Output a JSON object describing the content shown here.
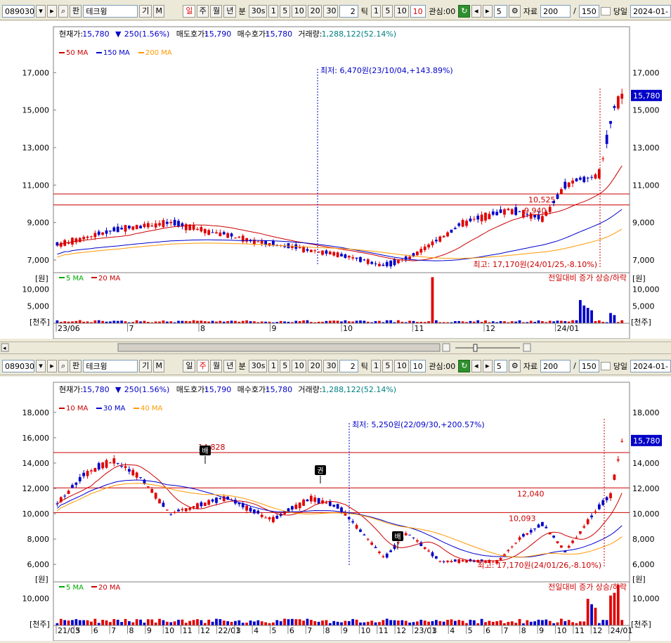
{
  "toolbar1": {
    "code": "089030",
    "pan": "판",
    "name": "테크윙",
    "gi": "기",
    "m": "M",
    "periods": [
      "일",
      "주",
      "월",
      "년",
      "분"
    ],
    "active_period": "일",
    "sec": "30s",
    "nums": [
      "1",
      "5",
      "10",
      "20",
      "30"
    ],
    "tick_count": "2",
    "tick_lbl": "틱",
    "tick_nums": [
      "1",
      "5",
      "10"
    ],
    "tick_active": "10",
    "gwansim": "관심:00",
    "spin": "5",
    "jaryo": "자료",
    "count": "200",
    "slash": "/",
    "total": "150",
    "dangil": "당일",
    "date": "2024-01-"
  },
  "toolbar2": {
    "code": "089030",
    "pan": "판",
    "name": "테크윙",
    "gi": "기",
    "m": "M",
    "periods": [
      "일",
      "주",
      "월",
      "년",
      "분"
    ],
    "active_period": "주",
    "sec": "30s",
    "nums": [
      "1",
      "5",
      "10",
      "20",
      "30"
    ],
    "tick_count": "2",
    "tick_lbl": "틱",
    "tick_nums": [
      "1",
      "5",
      "10"
    ],
    "tick_active": "10",
    "gwansim": "관심:00",
    "spin": "5",
    "jaryo": "자료",
    "count": "200",
    "slash": "/",
    "total": "150",
    "dangil": "당일",
    "date": "2024-01-"
  },
  "colors": {
    "up": "#e00000",
    "down": "#0000c8",
    "ma_red": "#cc0000",
    "ma_blue": "#0000cc",
    "ma_orange": "#ff9900",
    "vma_green": "#00aa00"
  },
  "chart1": {
    "info": {
      "cur_lbl": "현재가:",
      "cur": "15,780",
      "chg_arrow": "▼",
      "chg": "250(1.56%)",
      "ask_lbl": "매도호가:",
      "ask": "15,790",
      "bid_lbl": "매수호가:",
      "bid": "15,780",
      "vol_lbl": "거래량:",
      "vol": "1,288,122(52.14%)"
    },
    "legend": [
      {
        "name": "50 MA",
        "color": "#cc0000"
      },
      {
        "name": "150 MA",
        "color": "#0000cc"
      },
      {
        "name": "200 MA",
        "color": "#ff9900"
      }
    ],
    "vlegend": [
      {
        "name": "5 MA",
        "color": "#00aa00"
      },
      {
        "name": "20 MA",
        "color": "#cc0000"
      }
    ],
    "y_ticks": [
      "17,000",
      "15,000",
      "13,000",
      "11,000",
      "9,000",
      "7,000"
    ],
    "y_unit": "[원]",
    "price_tag": "15,780",
    "min_note": "최저: 6,470원(23/10/04,+143.89%)",
    "max_note": "최고: 17,170원(24/01/25,-8.10%)",
    "hline_labels": [
      "10,525",
      "9,940"
    ],
    "vol_ticks": [
      "10,000",
      "5,000"
    ],
    "vol_unit": "[천주]",
    "vol_note": "전일대비 증가 상승/하락",
    "x_labels": [
      "23/06",
      "7",
      "8",
      "9",
      "10",
      "11",
      "12",
      "24/01"
    ]
  },
  "chart2": {
    "info": {
      "cur_lbl": "현재가:",
      "cur": "15,780",
      "chg_arrow": "▼",
      "chg": "250(1.56%)",
      "ask_lbl": "매도호가:",
      "ask": "15,790",
      "bid_lbl": "매수호가:",
      "bid": "15,780",
      "vol_lbl": "거래량:",
      "vol": "1,288,122(52.14%)"
    },
    "legend": [
      {
        "name": "10 MA",
        "color": "#cc0000"
      },
      {
        "name": "30 MA",
        "color": "#0000cc"
      },
      {
        "name": "40 MA",
        "color": "#ff9900"
      }
    ],
    "vlegend": [
      {
        "name": "5 MA",
        "color": "#00aa00"
      },
      {
        "name": "20 MA",
        "color": "#cc0000"
      }
    ],
    "y_ticks": [
      "18,000",
      "16,000",
      "14,000",
      "12,000",
      "10,000",
      "8,000",
      "6,000"
    ],
    "y_unit": "[원]",
    "price_tag": "15,780",
    "min_note": "최저: 5,250원(22/09/30,+200.57%)",
    "max_note": "최고: 17,170원(24/01/26,-8.10%)",
    "hline_labels": [
      "14,828",
      "12,040",
      "10,093"
    ],
    "markers": [
      "배",
      "권",
      "배"
    ],
    "vol_ticks": [
      "10,000"
    ],
    "vol_unit": "[천주]",
    "vol_note": "전일대비 증가 상승/하락",
    "x_labels": [
      "21/03",
      "5",
      "6",
      "7",
      "8",
      "9",
      "10",
      "11",
      "12",
      "22/01",
      "3",
      "4",
      "5",
      "6",
      "7",
      "8",
      "9",
      "10",
      "11",
      "12",
      "23/01",
      "3",
      "4",
      "5",
      "6",
      "7",
      "8",
      "9",
      "10",
      "11",
      "12",
      "24/01"
    ]
  }
}
